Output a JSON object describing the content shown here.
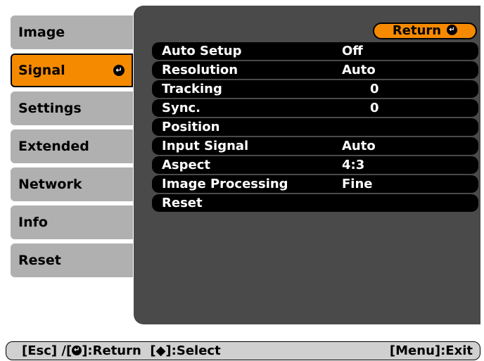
{
  "tabs": [
    {
      "label": "Image"
    },
    {
      "label": "Signal",
      "active": true
    },
    {
      "label": "Settings"
    },
    {
      "label": "Extended"
    },
    {
      "label": "Network"
    },
    {
      "label": "Info"
    },
    {
      "label": "Reset"
    }
  ],
  "return_button": {
    "label": "Return"
  },
  "rows": [
    {
      "label": "Auto Setup",
      "value": "Off"
    },
    {
      "label": "Resolution",
      "value": "Auto"
    },
    {
      "label": "Tracking",
      "value": "0"
    },
    {
      "label": "Sync.",
      "value": "0"
    },
    {
      "label": "Position",
      "value": ""
    },
    {
      "label": "Input Signal",
      "value": "Auto"
    },
    {
      "label": "Aspect",
      "value": "4:3"
    },
    {
      "label": "Image Processing",
      "value": "Fine"
    },
    {
      "label": "Reset",
      "value": ""
    }
  ],
  "status": {
    "esc_prefix": "[Esc] /[",
    "return_suffix": "]:Return",
    "select_text": "[◆]:Select",
    "exit_text": "[Menu]:Exit"
  },
  "icons": {
    "enter": "enter-key-icon",
    "select": "up-down-arrow-icon"
  },
  "colors": {
    "accent": "#f58a00",
    "tab": "#b0b0b0",
    "panel": "#4a4a4a"
  }
}
